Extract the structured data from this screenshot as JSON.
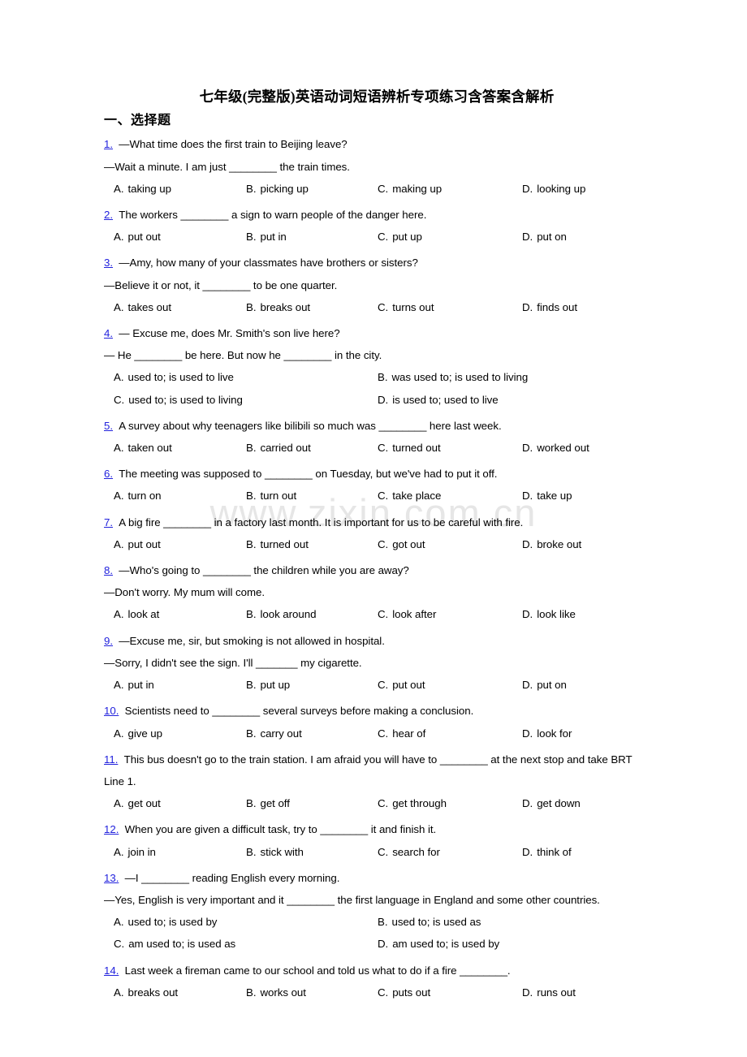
{
  "watermark": "www.zixin.com.cn",
  "document": {
    "title": "七年级(完整版)英语动词短语辨析专项练习含答案含解析",
    "section_heading": "一、选择题"
  },
  "questions": [
    {
      "number": "1.",
      "lines": [
        "—What time does the first train to Beijing leave?",
        "—Wait a minute. I am just ________ the train times."
      ],
      "layout": "4",
      "options": [
        {
          "letter": "A.",
          "text": "taking up"
        },
        {
          "letter": "B.",
          "text": "picking up"
        },
        {
          "letter": "C.",
          "text": "making up"
        },
        {
          "letter": "D.",
          "text": "looking up"
        }
      ]
    },
    {
      "number": "2.",
      "lines": [
        "The workers ________ a sign to warn people of the danger here."
      ],
      "layout": "4",
      "options": [
        {
          "letter": "A.",
          "text": "put out"
        },
        {
          "letter": "B.",
          "text": "put in"
        },
        {
          "letter": "C.",
          "text": "put up"
        },
        {
          "letter": "D.",
          "text": "put on"
        }
      ]
    },
    {
      "number": "3.",
      "lines": [
        "—Amy, how many of your classmates have brothers or sisters?",
        "—Believe it or not, it ________ to be one quarter."
      ],
      "layout": "4",
      "options": [
        {
          "letter": "A.",
          "text": "takes out"
        },
        {
          "letter": "B.",
          "text": "breaks out"
        },
        {
          "letter": "C.",
          "text": "turns out"
        },
        {
          "letter": "D.",
          "text": "finds out"
        }
      ]
    },
    {
      "number": "4.",
      "lines": [
        "— Excuse me, does Mr. Smith's son live here?",
        "— He ________ be here. But now he ________ in the city."
      ],
      "layout": "2",
      "options": [
        {
          "letter": "A.",
          "text": "used to; is used to live"
        },
        {
          "letter": "B.",
          "text": "was used to; is used to living"
        },
        {
          "letter": "C.",
          "text": "used to; is used to living"
        },
        {
          "letter": "D.",
          "text": "is used to; used to live"
        }
      ]
    },
    {
      "number": "5.",
      "lines": [
        "A survey about why teenagers like bilibili so much was ________ here last week."
      ],
      "layout": "4",
      "options": [
        {
          "letter": "A.",
          "text": "taken out"
        },
        {
          "letter": "B.",
          "text": "carried out"
        },
        {
          "letter": "C.",
          "text": "turned out"
        },
        {
          "letter": "D.",
          "text": "worked out"
        }
      ]
    },
    {
      "number": "6.",
      "lines": [
        "The meeting was supposed to ________ on Tuesday, but we've had to put it off."
      ],
      "layout": "4",
      "options": [
        {
          "letter": "A.",
          "text": "turn on"
        },
        {
          "letter": "B.",
          "text": "turn out"
        },
        {
          "letter": "C.",
          "text": "take place"
        },
        {
          "letter": "D.",
          "text": "take up"
        }
      ]
    },
    {
      "number": "7.",
      "lines": [
        "A big fire ________ in a factory last month. It is important for us to be careful with fire."
      ],
      "layout": "4",
      "options": [
        {
          "letter": "A.",
          "text": "put out"
        },
        {
          "letter": "B.",
          "text": "turned out"
        },
        {
          "letter": "C.",
          "text": "got out"
        },
        {
          "letter": "D.",
          "text": "broke out"
        }
      ]
    },
    {
      "number": "8.",
      "lines": [
        "—Who's going to ________ the children while you are away?",
        "—Don't worry. My mum will come."
      ],
      "layout": "4",
      "options": [
        {
          "letter": "A.",
          "text": "look at"
        },
        {
          "letter": "B.",
          "text": "look around"
        },
        {
          "letter": "C.",
          "text": "look after"
        },
        {
          "letter": "D.",
          "text": "look like"
        }
      ]
    },
    {
      "number": "9.",
      "lines": [
        "—Excuse me, sir, but smoking is not allowed in hospital.",
        "—Sorry, I didn't see the sign. I'll _______ my cigarette."
      ],
      "layout": "4",
      "options": [
        {
          "letter": "A.",
          "text": "put in"
        },
        {
          "letter": "B.",
          "text": "put up"
        },
        {
          "letter": "C.",
          "text": "put out"
        },
        {
          "letter": "D.",
          "text": "put on"
        }
      ]
    },
    {
      "number": "10.",
      "lines": [
        "Scientists need to ________ several surveys before making a conclusion."
      ],
      "layout": "4",
      "options": [
        {
          "letter": "A.",
          "text": "give up"
        },
        {
          "letter": "B.",
          "text": "carry out"
        },
        {
          "letter": "C.",
          "text": "hear of"
        },
        {
          "letter": "D.",
          "text": "look for"
        }
      ]
    },
    {
      "number": "11.",
      "lines": [
        "This bus doesn't go to the train station. I am afraid you will have to ________ at the next stop and take BRT Line 1."
      ],
      "layout": "4",
      "options": [
        {
          "letter": "A.",
          "text": "get out"
        },
        {
          "letter": "B.",
          "text": "get off"
        },
        {
          "letter": "C.",
          "text": "get through"
        },
        {
          "letter": "D.",
          "text": "get down"
        }
      ]
    },
    {
      "number": "12.",
      "lines": [
        "When you are given a difficult task, try to ________ it and finish it."
      ],
      "layout": "4",
      "options": [
        {
          "letter": "A.",
          "text": "join in"
        },
        {
          "letter": "B.",
          "text": "stick with"
        },
        {
          "letter": "C.",
          "text": "search for"
        },
        {
          "letter": "D.",
          "text": "think of"
        }
      ]
    },
    {
      "number": "13.",
      "lines": [
        "—I ________ reading English every morning.",
        "—Yes, English is very important and it ________ the first language in England and some other countries."
      ],
      "layout": "2",
      "options": [
        {
          "letter": "A.",
          "text": "used to; is used by"
        },
        {
          "letter": "B.",
          "text": "used to; is used as"
        },
        {
          "letter": "C.",
          "text": "am used to; is used as"
        },
        {
          "letter": "D.",
          "text": "am used to; is used by"
        }
      ]
    },
    {
      "number": "14.",
      "lines": [
        "Last week a fireman came to our school and told us what to do if a fire ________."
      ],
      "layout": "4",
      "options": [
        {
          "letter": "A.",
          "text": "breaks out"
        },
        {
          "letter": "B.",
          "text": "works out"
        },
        {
          "letter": "C.",
          "text": "puts out"
        },
        {
          "letter": "D.",
          "text": "runs out"
        }
      ]
    }
  ]
}
